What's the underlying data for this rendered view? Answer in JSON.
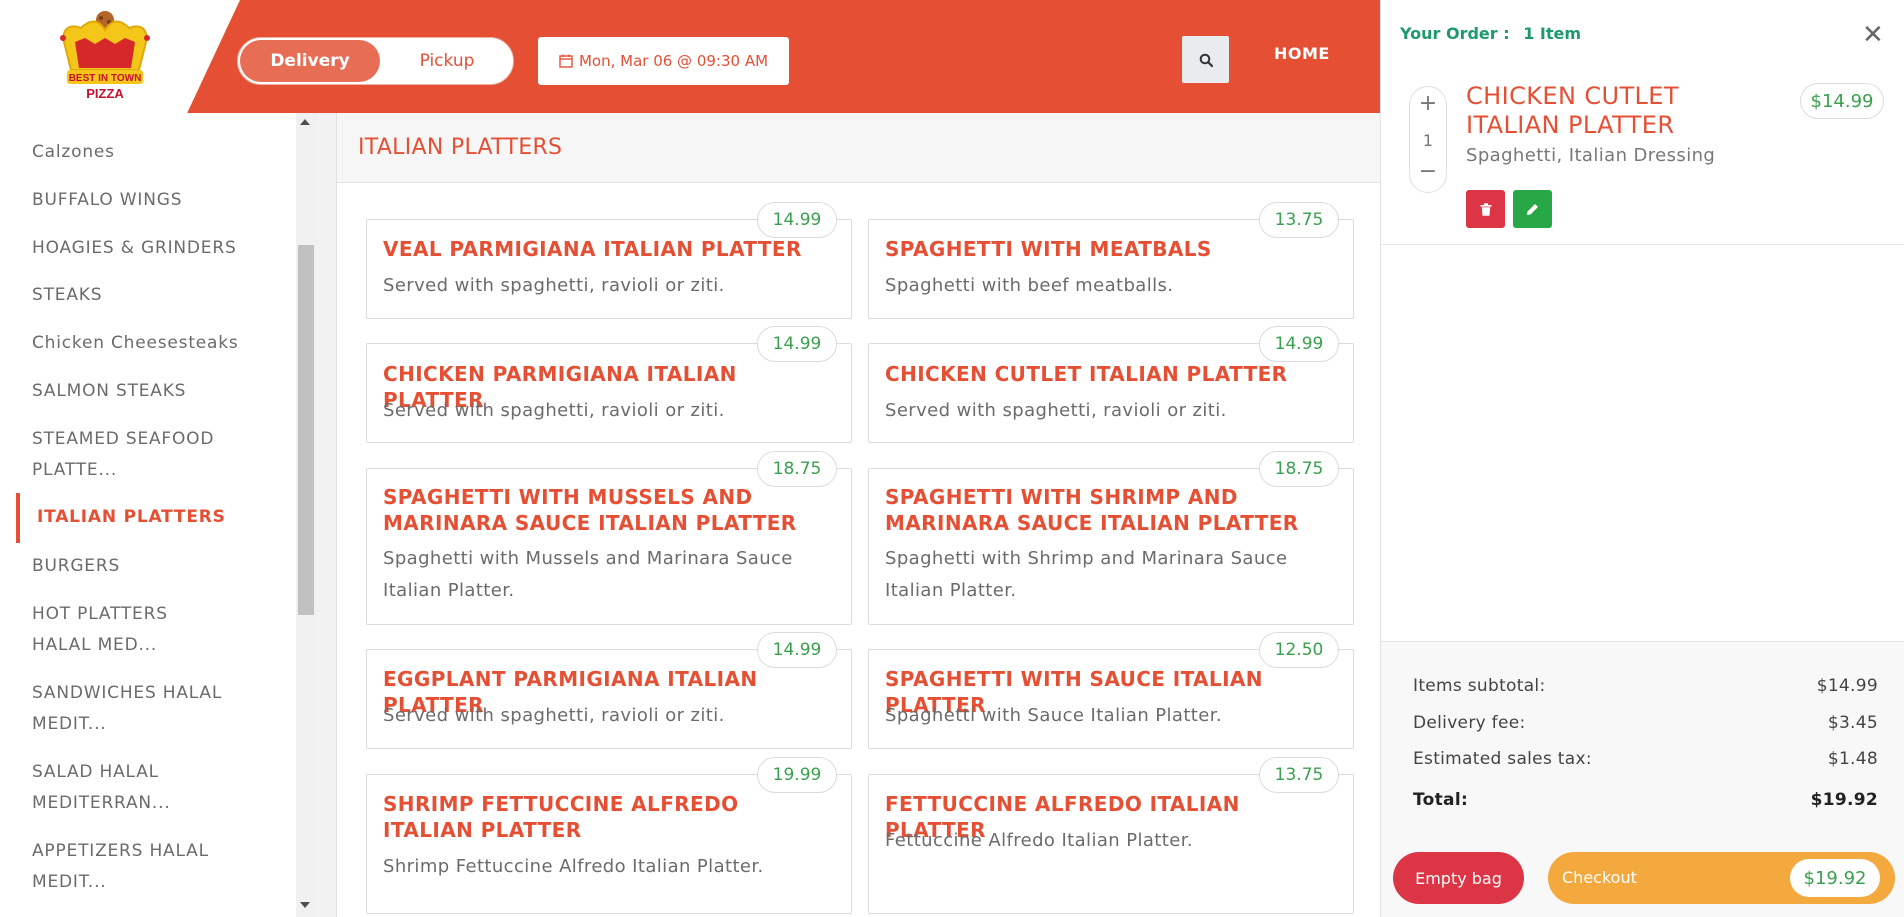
{
  "brand": {
    "logo_text": "BEST IN TOWN PIZZA"
  },
  "header": {
    "order_type": {
      "active": "Delivery",
      "inactive": "Pickup"
    },
    "schedule": "Mon, Mar 06 @ 09:30 AM",
    "nav_home": "HOME"
  },
  "sidebar": {
    "categories": [
      "Calzones",
      "BUFFALO WINGS",
      "HOAGIES & GRINDERS",
      "STEAKS",
      "Chicken Cheesesteaks",
      "SALMON STEAKS",
      "STEAMED SEAFOOD PLATTE...",
      "ITALIAN PLATTERS",
      "BURGERS",
      "HOT PLATTERS HALAL MED...",
      "SANDWICHES HALAL MEDIT...",
      "SALAD HALAL MEDITERRAN...",
      "APPETIZERS HALAL MEDIT..."
    ],
    "active_index": 7
  },
  "menu": {
    "section_title": "ITALIAN PLATTERS",
    "items": [
      {
        "name": "VEAL PARMIGIANA ITALIAN PLATTER",
        "desc": "Served with spaghetti, ravioli or ziti.",
        "price": "14.99"
      },
      {
        "name": "SPAGHETTI WITH MEATBALS",
        "desc": "Spaghetti with beef meatballs.",
        "price": "13.75"
      },
      {
        "name": "CHICKEN PARMIGIANA ITALIAN PLATTER",
        "desc": "Served with spaghetti, ravioli or ziti.",
        "price": "14.99"
      },
      {
        "name": "CHICKEN CUTLET ITALIAN PLATTER",
        "desc": "Served with spaghetti, ravioli or ziti.",
        "price": "14.99"
      },
      {
        "name": "SPAGHETTI WITH MUSSELS AND MARINARA SAUCE ITALIAN PLATTER",
        "desc": "Spaghetti with Mussels and Marinara Sauce Italian Platter.",
        "price": "18.75"
      },
      {
        "name": "SPAGHETTI WITH SHRIMP AND MARINARA SAUCE ITALIAN PLATTER",
        "desc": "Spaghetti with Shrimp and Marinara Sauce Italian Platter.",
        "price": "18.75"
      },
      {
        "name": "EGGPLANT PARMIGIANA ITALIAN PLATTER",
        "desc": "Served with spaghetti, ravioli or ziti.",
        "price": "14.99"
      },
      {
        "name": "SPAGHETTI WITH SAUCE ITALIAN PLATTER",
        "desc": "Spaghetti with Sauce Italian Platter.",
        "price": "12.50"
      },
      {
        "name": "SHRIMP FETTUCCINE ALFREDO ITALIAN PLATTER",
        "desc": "Shrimp Fettuccine Alfredo Italian Platter.",
        "price": "19.99"
      },
      {
        "name": "FETTUCCINE ALFREDO ITALIAN PLATTER",
        "desc": "Fettuccine Alfredo Italian Platter.",
        "price": "13.75"
      }
    ]
  },
  "order": {
    "title_label": "Your Order :",
    "item_count": "1 Item",
    "item": {
      "name": "CHICKEN CUTLET ITALIAN PLATTER",
      "price": "$14.99",
      "modifiers": "Spaghetti, Italian Dressing",
      "quantity": "1"
    },
    "summary": {
      "subtotal_label": "Items subtotal:",
      "subtotal": "$14.99",
      "delivery_label": "Delivery fee:",
      "delivery": "$3.45",
      "tax_label": "Estimated sales tax:",
      "tax": "$1.48",
      "total_label": "Total:",
      "total": "$19.92"
    },
    "empty_label": "Empty bag",
    "checkout_label": "Checkout",
    "checkout_amount": "$19.92"
  },
  "colors": {
    "brand": "#e55035",
    "price": "#39a04d",
    "checkout": "#f4a93e",
    "danger": "#dc3545",
    "success": "#27a745"
  }
}
